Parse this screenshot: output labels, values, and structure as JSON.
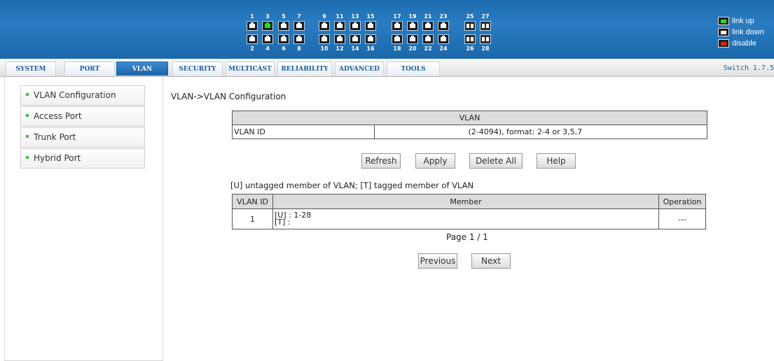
{
  "header": {
    "port_numbers_top": [
      "1",
      "3",
      "5",
      "7",
      "9",
      "11",
      "13",
      "15",
      "17",
      "19",
      "21",
      "23",
      "25",
      "27"
    ],
    "port_numbers_bottom": [
      "2",
      "4",
      "6",
      "8",
      "10",
      "12",
      "14",
      "16",
      "18",
      "20",
      "22",
      "24",
      "26",
      "28"
    ],
    "link_up_ports": [
      "3"
    ],
    "legend": {
      "link_up": "link up",
      "link_down": "link down",
      "disable": "disable"
    },
    "colors": {
      "banner": "#1d6cb0",
      "link_up": "#20e020",
      "disable": "#e02020"
    }
  },
  "nav": {
    "tabs": [
      {
        "label": "SYSTEM"
      },
      {
        "label": "PORT"
      },
      {
        "label": "VLAN",
        "active": true
      },
      {
        "label": "SECURITY"
      },
      {
        "label": "MULTICAST"
      },
      {
        "label": "RELIABILITY"
      },
      {
        "label": "ADVANCED"
      },
      {
        "label": "TOOLS"
      }
    ],
    "version": "Switch 1.7.5"
  },
  "sidebar": {
    "items": [
      {
        "label": "VLAN Configuration"
      },
      {
        "label": "Access Port"
      },
      {
        "label": "Trunk Port"
      },
      {
        "label": "Hybrid Port"
      }
    ]
  },
  "main": {
    "breadcrumb": "VLAN->VLAN Configuration",
    "vlan_form": {
      "header": "VLAN",
      "field_label": "VLAN ID",
      "field_value": "",
      "hint": "(2-4094), format: 2-4 or 3,5,7"
    },
    "buttons": {
      "refresh": "Refresh",
      "apply": "Apply",
      "delete_all": "Delete All",
      "help": "Help"
    },
    "member_legend": "[U] untagged member of VLAN;  [T] tagged member of VLAN",
    "member_table": {
      "columns": [
        "VLAN ID",
        "Member",
        "Operation"
      ],
      "rows": [
        {
          "vlan_id": "1",
          "untagged": "[U] : 1-28",
          "tagged": "[T] :",
          "operation": "---"
        }
      ]
    },
    "pager": {
      "text": "Page 1  /  1",
      "previous": "Previous",
      "next": "Next"
    }
  }
}
